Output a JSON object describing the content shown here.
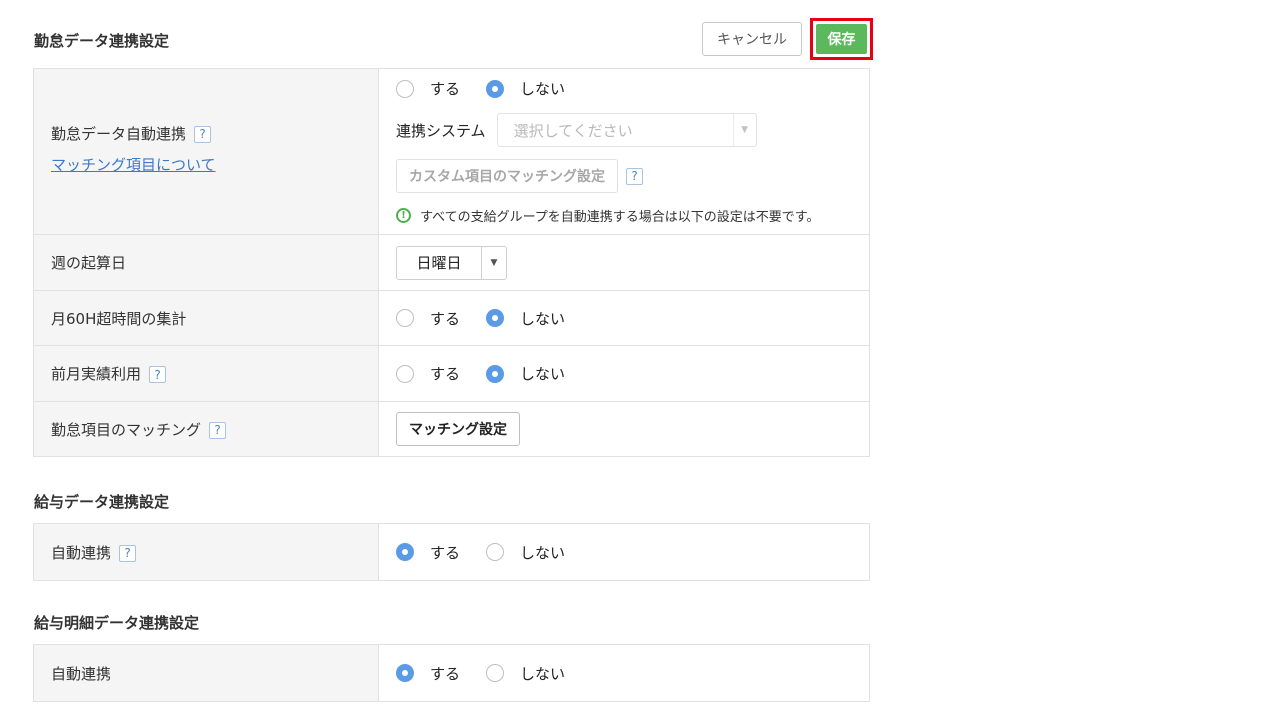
{
  "kintai": {
    "title": "勤怠データ連携設定",
    "cancel_label": "キャンセル",
    "save_label": "保存",
    "auto_link": {
      "label": "勤怠データ自動連携",
      "help": "?",
      "link": "マッチング項目について",
      "option_yes": "する",
      "option_no": "しない",
      "selected": "しない",
      "system_label": "連携システム",
      "system_placeholder": "選択してください",
      "custom_button": "カスタム項目のマッチング設定",
      "notice_icon": "exclamation-circle-icon",
      "notice": "すべての支給グループを自動連携する場合は以下の設定は不要です。"
    },
    "week_start": {
      "label": "週の起算日",
      "value": "日曜日"
    },
    "overtime60": {
      "label": "月60H超時間の集計",
      "option_yes": "する",
      "option_no": "しない",
      "selected": "しない"
    },
    "prev_month": {
      "label": "前月実績利用",
      "help": "?",
      "option_yes": "する",
      "option_no": "しない",
      "selected": "しない"
    },
    "matching": {
      "label": "勤怠項目のマッチング",
      "help": "?",
      "button": "マッチング設定"
    }
  },
  "salary": {
    "title": "給与データ連携設定",
    "auto_link": {
      "label": "自動連携",
      "help": "?",
      "option_yes": "する",
      "option_no": "しない",
      "selected": "する"
    }
  },
  "payslip": {
    "title": "給与明細データ連携設定",
    "auto_link": {
      "label": "自動連携",
      "option_yes": "する",
      "option_no": "しない",
      "selected": "する"
    }
  },
  "colors": {
    "save": "#5cb85c",
    "highlight": "#e60012",
    "radio_checked": "#5b9be6",
    "link": "#3a78c9"
  }
}
